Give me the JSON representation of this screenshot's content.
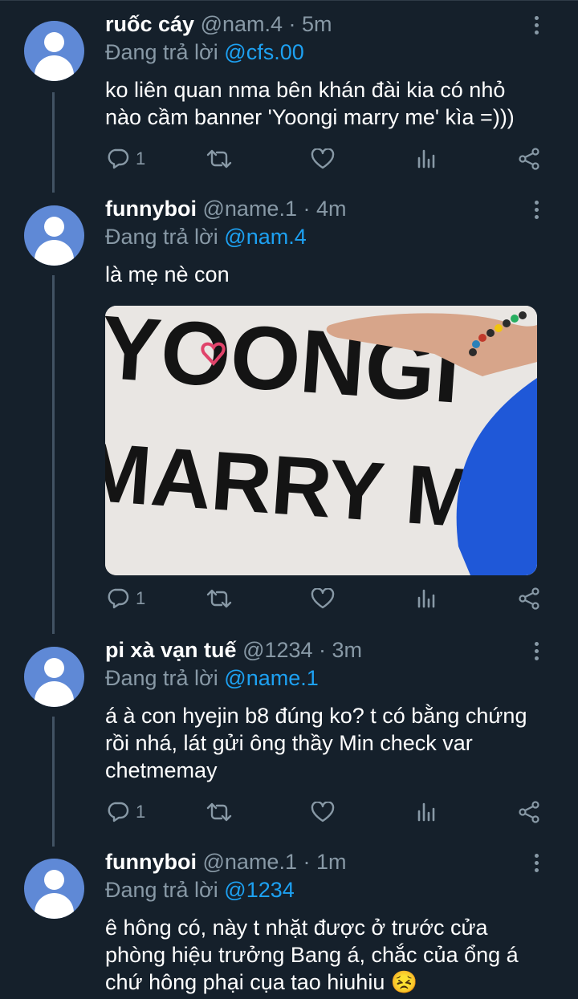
{
  "tweets": [
    {
      "name": "ruốc cáy",
      "meta": "@nam.4 · 5m",
      "reply_prefix": "Đang trả lời",
      "reply_to": "@cfs.00",
      "lines": [
        "ko liên quan nma bên khán đài kia có nhỏ",
        "nào cầm banner 'Yoongi marry me' kìa =)))"
      ],
      "reply_count": "1"
    },
    {
      "name": "funnyboi",
      "meta": "@name.1 · 4m",
      "reply_prefix": "Đang trả lời",
      "reply_to": "@nam.4",
      "lines": [
        "là mẹ nè con"
      ],
      "media_text": [
        "YOONGI",
        "MARRY ME"
      ],
      "reply_count": "1"
    },
    {
      "name": "pi xà vạn tuế",
      "meta": "@1234 · 3m",
      "reply_prefix": "Đang trả lời",
      "reply_to": "@name.1",
      "lines": [
        "á à con hyejin b8 đúng ko? t có bằng chứng",
        "rồi nhá, lát gửi ông thầy Min check var",
        "chetmemay"
      ],
      "reply_count": "1"
    },
    {
      "name": "funnyboi",
      "meta": "@name.1 · 1m",
      "reply_prefix": "Đang trả lời",
      "reply_to": "@1234",
      "lines": [
        "ê hông có, này t nhặt được ở trước cửa",
        "phòng hiệu trưởng Bang á, chắc của ổng á",
        "chứ hông phại cụa tao hiuhiu 😣"
      ]
    }
  ],
  "colors": {
    "background": "#15202b",
    "secondary_text": "#8899a6",
    "link": "#1da1f2",
    "avatar": "#5f89d6",
    "thread_line": "#425364"
  },
  "icons": [
    "reply-icon",
    "retweet-icon",
    "like-icon",
    "stats-icon",
    "share-icon",
    "more-icon"
  ]
}
